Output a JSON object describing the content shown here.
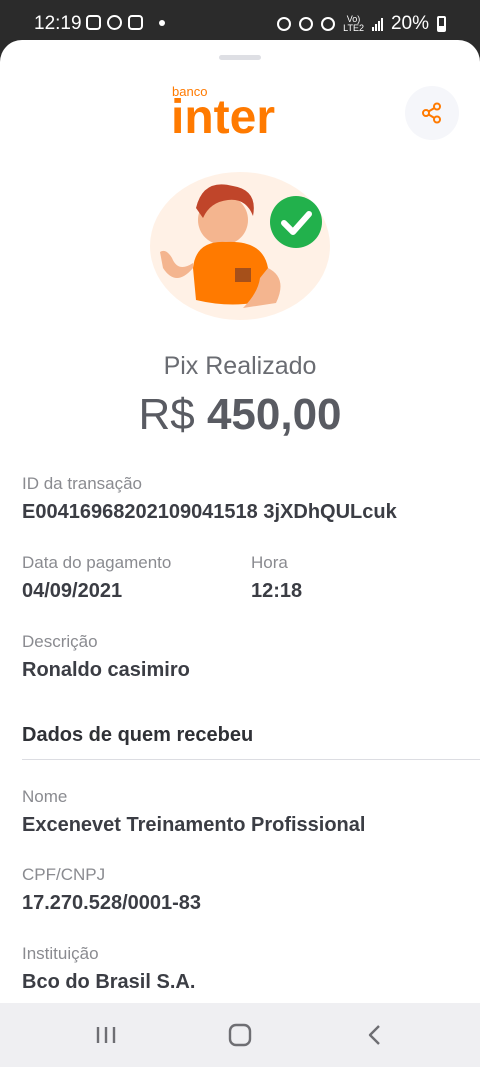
{
  "status_bar": {
    "time": "12:19",
    "battery": "20%",
    "network": "VoLTE2"
  },
  "header": {
    "brand_small": "banco",
    "brand_large": "inter",
    "brand_color": "#ff7a00",
    "share_icon": "share-icon"
  },
  "receipt": {
    "title": "Pix Realizado",
    "currency": "R$",
    "amount": "450,00"
  },
  "transaction": {
    "id_label": "ID da transação",
    "id_value": "E00416968202109041518 3jXDhQULcuk",
    "date_label": "Data do pagamento",
    "date_value": "04/09/2021",
    "time_label": "Hora",
    "time_value": "12:18",
    "desc_label": "Descrição",
    "desc_value": "Ronaldo casimiro"
  },
  "receiver": {
    "section_title": "Dados de quem recebeu",
    "name_label": "Nome",
    "name_value": "Excenevet Treinamento Profissional",
    "doc_label": "CPF/CNPJ",
    "doc_value": "17.270.528/0001-83",
    "inst_label": "Instituição",
    "inst_value": "Bco do Brasil S.A."
  },
  "nav": {
    "recents_icon": "recents-icon",
    "home_icon": "home-icon",
    "back_icon": "back-icon"
  }
}
